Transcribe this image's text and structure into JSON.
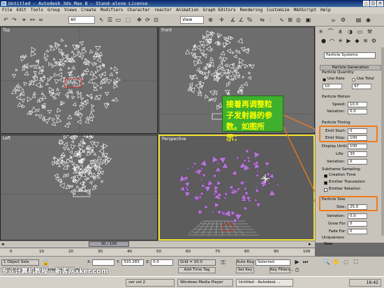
{
  "window": {
    "title": "Untitled - Autodesk 3ds Max 8 - Stand-alone License"
  },
  "menu": [
    "File",
    "Edit",
    "Tools",
    "Group",
    "Views",
    "Create",
    "Modifiers",
    "Character",
    "reactor",
    "Animation",
    "Graph Editors",
    "Rendering",
    "Customize",
    "MAXScript",
    "Help"
  ],
  "toolbar": {
    "selection_filter": "All",
    "ref_coord": "View"
  },
  "viewports": {
    "top": "Top",
    "front": "Front",
    "left": "Left",
    "perspective": "Perspective"
  },
  "annotation": {
    "text": "接着再调整粒子发射器的参数。如图所示："
  },
  "panel": {
    "object_type": "Particle Systems",
    "particle_generation": "Particle Generation",
    "particle_quantity": "Particle Quantity",
    "use_rate": "Use Rate",
    "use_total": "Use Total",
    "rate_value": "10",
    "total_value": "97",
    "particle_motion": "Particle Motion",
    "speed_label": "Speed:",
    "speed_value": "10.0",
    "variation_label": "Variation:",
    "variation_value": "0.0",
    "particle_timing": "Particle Timing",
    "emit_start_label": "Emit Start:",
    "emit_start_value": "0",
    "emit_stop_label": "Emit Stop:",
    "emit_stop_value": "100",
    "display_until_label": "Display Until:",
    "display_until_value": "100",
    "life_label": "Life:",
    "life_value": "30",
    "variation2_value": "0",
    "subframe": "Subframe Sampling:",
    "creation_time": "Creation Time",
    "emitter_translation": "Emitter Translation",
    "emitter_rotation": "Emitter Rotation",
    "particle_size": "Particle Size",
    "size_label": "Size:",
    "size_value": "25.0",
    "variation3_value": "0.0",
    "grow_for_label": "Grow For:",
    "grow_for_value": "0",
    "fade_for_label": "Fade For:",
    "fade_for_value": "0",
    "uniqueness": "Uniqueness",
    "new_label": "New"
  },
  "timeline": {
    "slider": "30 / 100",
    "ticks": [
      "0",
      "10",
      "20",
      "30",
      "40",
      "50",
      "60",
      "70",
      "80",
      "90",
      "100"
    ]
  },
  "status": {
    "selection": "1 Object Sele",
    "prompt": "Click and drag to begin creation process",
    "x_label": "X:",
    "y_label": "Y:",
    "y_value": "310.283",
    "z_label": "Z:",
    "z_value": "0.0",
    "grid": "Grid = 10.0",
    "add_time_tag": "Add Time Tag",
    "auto_key": "Auto Key",
    "auto_key_mode": "Selected",
    "set_key": "Set Key",
    "key_filters": "Key Filters..."
  },
  "taskbar": {
    "items": [
      "ver vol 2",
      "Windows Media Player",
      "Untitled - Autodesk ..."
    ],
    "clock": "16:42"
  },
  "watermark": "专业计算机教程 · 新客网xker.com",
  "colors": {
    "highlight": "#f07a1c",
    "note_bg": "#3fb02e",
    "note_text": "#ffff00",
    "active_viewport": "#f0e030"
  }
}
